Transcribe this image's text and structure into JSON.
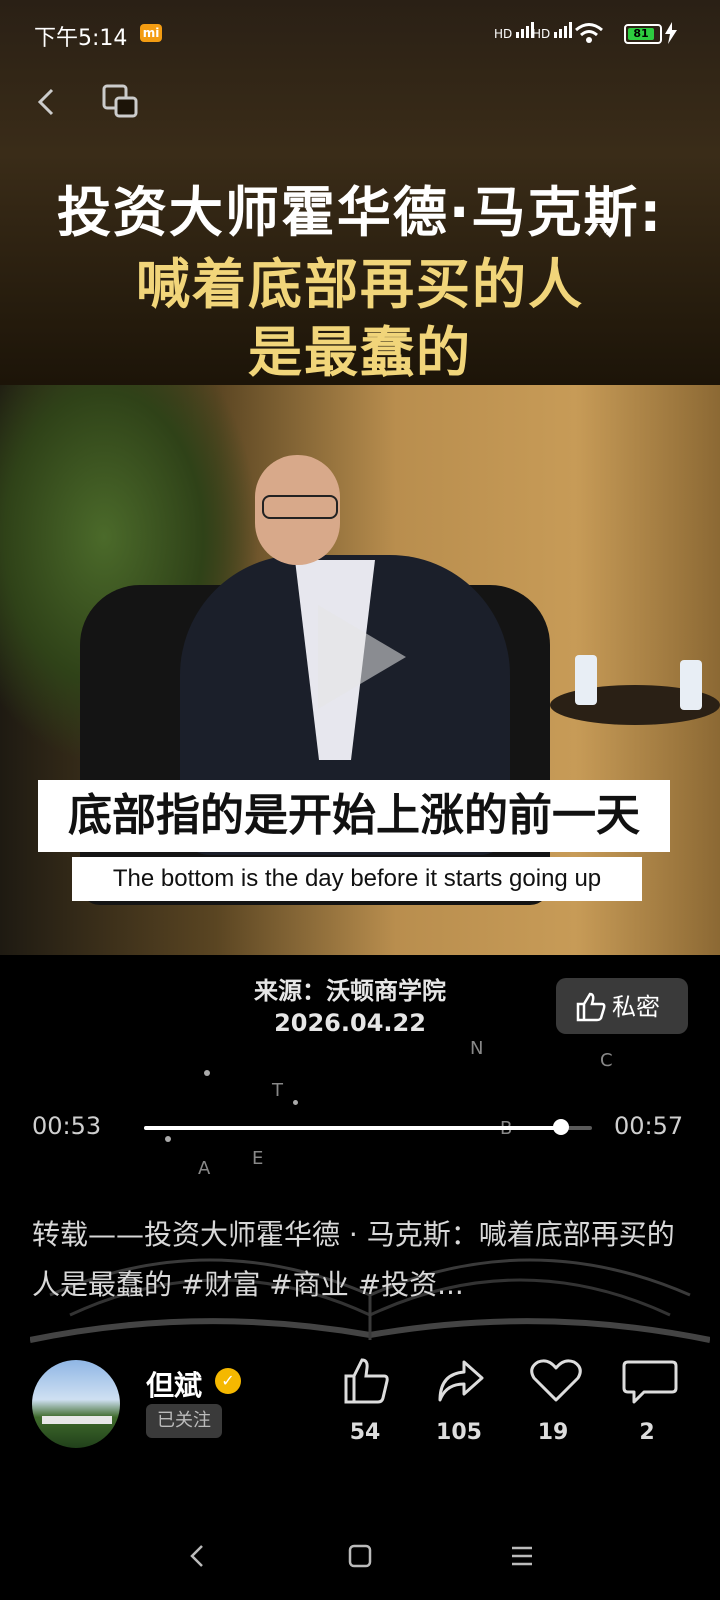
{
  "status_bar": {
    "time": "下午5:14",
    "mi_badge": "mi",
    "signal1": "HD",
    "signal2": "HD",
    "battery": "81"
  },
  "header": {
    "back_icon": "back-icon",
    "copy_icon": "copy-icon"
  },
  "hero": {
    "title_line1": "投资大师霍华德·马克斯:",
    "title_line2": "喊着底部再买的人",
    "title_line3": "是最蠢的"
  },
  "video": {
    "subtitle_cn": "底部指的是开始上涨的前一天",
    "subtitle_en": "The bottom is the day before it starts going up",
    "play_icon": "play-icon"
  },
  "source": {
    "line1": "来源：沃顿商学院",
    "line2": "2026.04.22"
  },
  "private_button": {
    "label": "私密",
    "icon": "thumb-icon"
  },
  "decor_letters": [
    "N",
    "C",
    "T",
    "B",
    "A",
    "E"
  ],
  "progress": {
    "current": "00:53",
    "total": "00:57",
    "fraction": 0.93
  },
  "caption": "转载——投资大师霍华德 · 马克斯：喊着底部再买的人是最蠢的 #财富 #商业 #投资...",
  "author": {
    "name": "但斌",
    "follow_label": "已关注",
    "verified": "✓"
  },
  "actions": [
    {
      "name": "like",
      "count": "54"
    },
    {
      "name": "share",
      "count": "105"
    },
    {
      "name": "favorite",
      "count": "19"
    },
    {
      "name": "comment",
      "count": "2"
    }
  ],
  "nav": [
    "back",
    "home",
    "menu"
  ],
  "colors": {
    "title_gold": "#f1d57a",
    "bg": "#000000",
    "battery_green": "#2ecc40",
    "verified_yellow": "#f5b800"
  }
}
